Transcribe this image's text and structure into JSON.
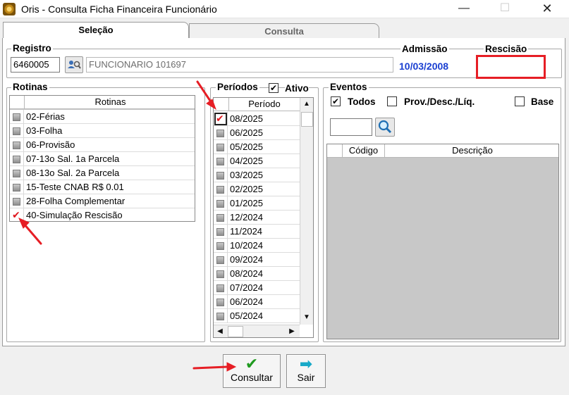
{
  "window": {
    "title": "Oris - Consulta Ficha Financeira Funcionário",
    "min_glyph": "—",
    "max_glyph": "☐",
    "close_glyph": "✕"
  },
  "tabs": [
    {
      "label": "Seleção",
      "active": true
    },
    {
      "label": "Consulta",
      "active": false
    }
  ],
  "registro": {
    "legend": "Registro",
    "value": "6460005",
    "employee_name": "FUNCIONARIO 101697",
    "lookup_icon": "people-search-icon"
  },
  "admissao": {
    "label": "Admissão",
    "value": "10/03/2008"
  },
  "rescisao": {
    "label": "Rescisão",
    "value": ""
  },
  "rotinas": {
    "legend": "Rotinas",
    "column_header": "Rotinas",
    "items": [
      {
        "label": "02-Férias",
        "checked": false
      },
      {
        "label": "03-Folha",
        "checked": false
      },
      {
        "label": "06-Provisão",
        "checked": false
      },
      {
        "label": "07-13o Sal. 1a Parcela",
        "checked": false
      },
      {
        "label": "08-13o Sal. 2a Parcela",
        "checked": false
      },
      {
        "label": "15-Teste CNAB R$ 0.01",
        "checked": false
      },
      {
        "label": "28-Folha Complementar",
        "checked": false
      },
      {
        "label": "40-Simulação Rescisão",
        "checked": true
      }
    ]
  },
  "periodos": {
    "legend": "Períodos",
    "ativo_label": "Ativo",
    "ativo_checked": true,
    "column_header": "Período",
    "items": [
      {
        "label": "08/2025",
        "checked": true
      },
      {
        "label": "06/2025",
        "checked": false
      },
      {
        "label": "05/2025",
        "checked": false
      },
      {
        "label": "04/2025",
        "checked": false
      },
      {
        "label": "03/2025",
        "checked": false
      },
      {
        "label": "02/2025",
        "checked": false
      },
      {
        "label": "01/2025",
        "checked": false
      },
      {
        "label": "12/2024",
        "checked": false
      },
      {
        "label": "11/2024",
        "checked": false
      },
      {
        "label": "10/2024",
        "checked": false
      },
      {
        "label": "09/2024",
        "checked": false
      },
      {
        "label": "08/2024",
        "checked": false
      },
      {
        "label": "07/2024",
        "checked": false
      },
      {
        "label": "06/2024",
        "checked": false
      },
      {
        "label": "05/2024",
        "checked": false
      }
    ]
  },
  "eventos": {
    "legend": "Eventos",
    "todos_label": "Todos",
    "todos_checked": true,
    "prov_label": "Prov./Desc./Líq.",
    "prov_checked": false,
    "base_label": "Base",
    "base_checked": false,
    "search_value": "",
    "search_icon": "magnifier-icon",
    "columns": [
      "Código",
      "Descrição"
    ]
  },
  "buttons": {
    "consultar": {
      "label": "Consultar",
      "icon": "green-check-icon",
      "glyph": "✔"
    },
    "sair": {
      "label": "Sair",
      "icon": "exit-arrow-icon",
      "glyph": "➡"
    }
  },
  "colors": {
    "annotation_red": "#e61e25",
    "date_blue": "#1a3fd1",
    "check_red": "#e0161d"
  },
  "glyphs": {
    "check": "✔",
    "scroll_up": "▲",
    "scroll_down": "▼",
    "scroll_left": "◀",
    "scroll_right": "▶"
  }
}
